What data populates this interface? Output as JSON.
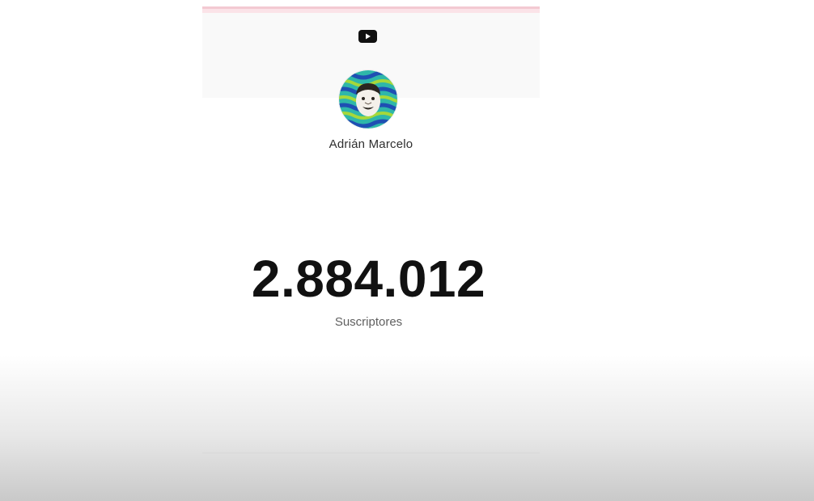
{
  "channel": {
    "platform_icon": "youtube-icon",
    "avatar_icon": "channel-avatar",
    "name": "Adrián Marcelo",
    "subscriber_count": "2.884.012",
    "subscriber_label": "Suscriptores"
  },
  "colors": {
    "header_background": "#f9f9f9",
    "top_accent": "#f3c9d2",
    "count_text": "#111111",
    "label_text": "#606060",
    "avatar_teal": "#2fb7a9",
    "avatar_blue": "#1f4fb3"
  }
}
